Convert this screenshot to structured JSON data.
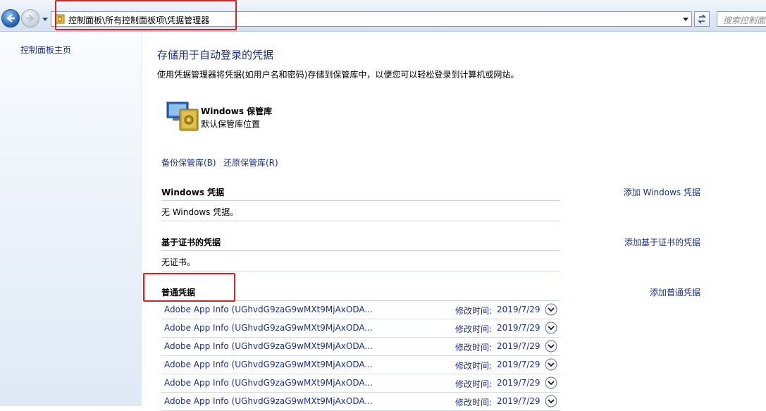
{
  "address": {
    "path": "控制面板\\所有控制面板项\\凭据管理器",
    "search_placeholder": "搜索控制面板"
  },
  "sidebar": {
    "home_label": "控制面板主页"
  },
  "main": {
    "title": "存储用于自动登录的凭据",
    "description": "使用凭据管理器将凭据(如用户名和密码)存储到保管库中，以便您可以轻松登录到计算机或网站。",
    "vault": {
      "name": "Windows 保管库",
      "location": "默认保管库位置"
    },
    "backup_label": "备份保管库(B)",
    "restore_label": "还原保管库(R)",
    "windows_section": {
      "heading": "Windows 凭据",
      "add_label": "添加 Windows 凭据",
      "empty_text": "无 Windows 凭据。"
    },
    "cert_section": {
      "heading": "基于证书的凭据",
      "add_label": "添加基于证书的凭据",
      "empty_text": "无证书。"
    },
    "generic_section": {
      "heading": "普通凭据",
      "add_label": "添加普通凭据",
      "items": [
        {
          "name": "Adobe App Info (UGhvdG9zaG9wMXt9MjAxODA...",
          "modified_label": "修改时间:",
          "date": "2019/7/29"
        },
        {
          "name": "Adobe App Info (UGhvdG9zaG9wMXt9MjAxODA...",
          "modified_label": "修改时间:",
          "date": "2019/7/29"
        },
        {
          "name": "Adobe App Info (UGhvdG9zaG9wMXt9MjAxODA...",
          "modified_label": "修改时间:",
          "date": "2019/7/29"
        },
        {
          "name": "Adobe App Info (UGhvdG9zaG9wMXt9MjAxODA...",
          "modified_label": "修改时间:",
          "date": "2019/7/29"
        },
        {
          "name": "Adobe App Info (UGhvdG9zaG9wMXt9MjAxODA...",
          "modified_label": "修改时间:",
          "date": "2019/7/29"
        },
        {
          "name": "Adobe App Info (UGhvdG9zaG9wMXt9MjAxODA...",
          "modified_label": "修改时间:",
          "date": "2019/7/29"
        }
      ]
    }
  },
  "colors": {
    "link": "#1e3287",
    "highlight_box": "#e02020"
  }
}
